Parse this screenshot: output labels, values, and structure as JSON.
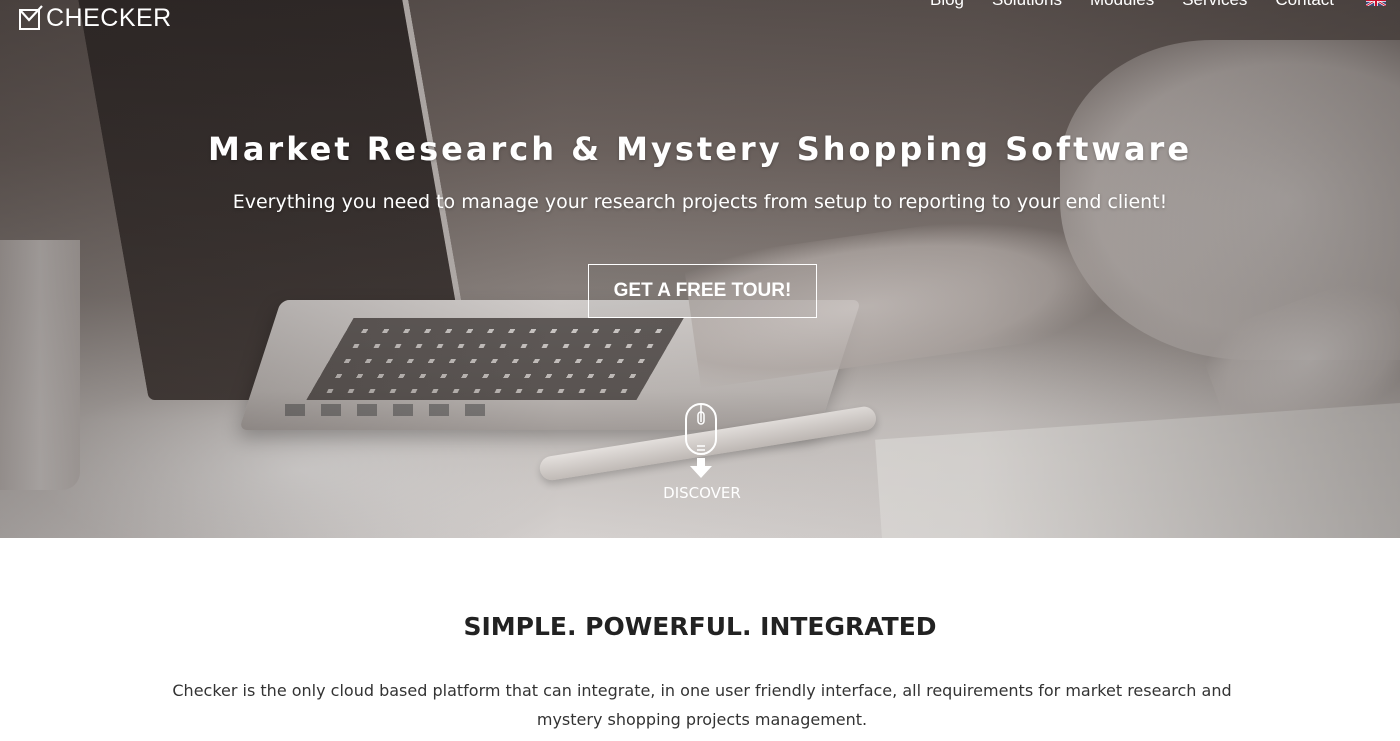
{
  "brand": {
    "logo_text": "CHECKER",
    "logo_icon": "checkbox-icon"
  },
  "nav": {
    "items": [
      {
        "label": "Blog"
      },
      {
        "label": "Solutions"
      },
      {
        "label": "Modules"
      },
      {
        "label": "Services"
      },
      {
        "label": "Contact"
      }
    ],
    "language_icon": "uk-flag-icon"
  },
  "hero": {
    "title": "Market Research & Mystery Shopping Software",
    "subtitle": "Everything you need to manage your research projects from setup to reporting to your end client!",
    "cta_label": "GET A FREE TOUR!",
    "discover_label": "DISCOVER",
    "discover_icon": "mouse-scroll-down-icon"
  },
  "intro": {
    "title": "SIMPLE. POWERFUL. INTEGRATED",
    "body": "Checker is the only cloud based platform that can integrate, in one user friendly interface, all requirements for market research and mystery shopping projects management."
  },
  "colors": {
    "hero_text": "#ffffff",
    "heading_text": "#222222",
    "body_text": "#333333",
    "page_background": "#ffffff"
  }
}
